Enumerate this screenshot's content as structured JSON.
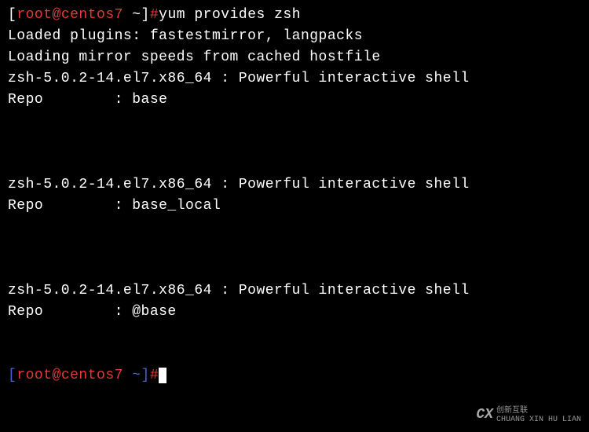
{
  "prompt": {
    "bracket_open": "[",
    "user_host": "root@centos7",
    "tilde": " ~",
    "bracket_close": "]",
    "hash": "#"
  },
  "command": "yum provides zsh",
  "output": {
    "line1": "Loaded plugins: fastestmirror, langpacks",
    "line2": "Loading mirror speeds from cached hostfile",
    "result1_pkg": "zsh-5.0.2-14.el7.x86_64 : Powerful interactive shell",
    "result1_repo": "Repo        : base",
    "result2_pkg": "zsh-5.0.2-14.el7.x86_64 : Powerful interactive shell",
    "result2_repo": "Repo        : base_local",
    "result3_pkg": "zsh-5.0.2-14.el7.x86_64 : Powerful interactive shell",
    "result3_repo": "Repo        : @base"
  },
  "watermark": {
    "logo_text": "CX",
    "line1": "创新互联",
    "line2": "CHUANG XIN HU LIAN"
  }
}
